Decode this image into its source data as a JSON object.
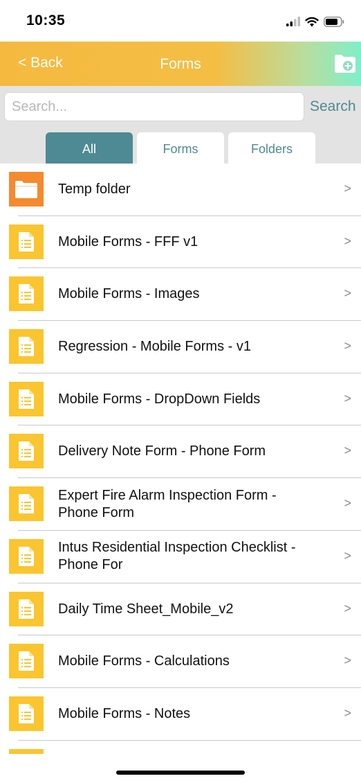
{
  "status_bar": {
    "time": "10:35"
  },
  "nav": {
    "back_label": "< Back",
    "title": "Forms"
  },
  "search": {
    "placeholder": "Search...",
    "button_label": "Search"
  },
  "tabs": [
    {
      "label": "All",
      "active": true
    },
    {
      "label": "Forms",
      "active": false
    },
    {
      "label": "Folders",
      "active": false
    }
  ],
  "items": [
    {
      "type": "folder",
      "label": "Temp folder"
    },
    {
      "type": "form",
      "label": "Mobile Forms - FFF v1"
    },
    {
      "type": "form",
      "label": "Mobile Forms - Images"
    },
    {
      "type": "form",
      "label": "Regression - Mobile Forms - v1"
    },
    {
      "type": "form",
      "label": "Mobile Forms - DropDown Fields"
    },
    {
      "type": "form",
      "label": "Delivery Note Form - Phone Form"
    },
    {
      "type": "form",
      "label": "Expert Fire Alarm Inspection Form - Phone Form"
    },
    {
      "type": "form",
      "label": "Intus Residential Inspection Checklist - Phone For"
    },
    {
      "type": "form",
      "label": "Daily Time Sheet_Mobile_v2"
    },
    {
      "type": "form",
      "label": "Mobile Forms - Calculations"
    },
    {
      "type": "form",
      "label": "Mobile Forms - Notes"
    },
    {
      "type": "form",
      "label": ""
    }
  ],
  "chevron": ">",
  "colors": {
    "nav_start": "#f5b93f",
    "nav_end": "#7fefc9",
    "accent": "#4e8a94",
    "folder": "#f58a2f",
    "form": "#fbc52f"
  }
}
